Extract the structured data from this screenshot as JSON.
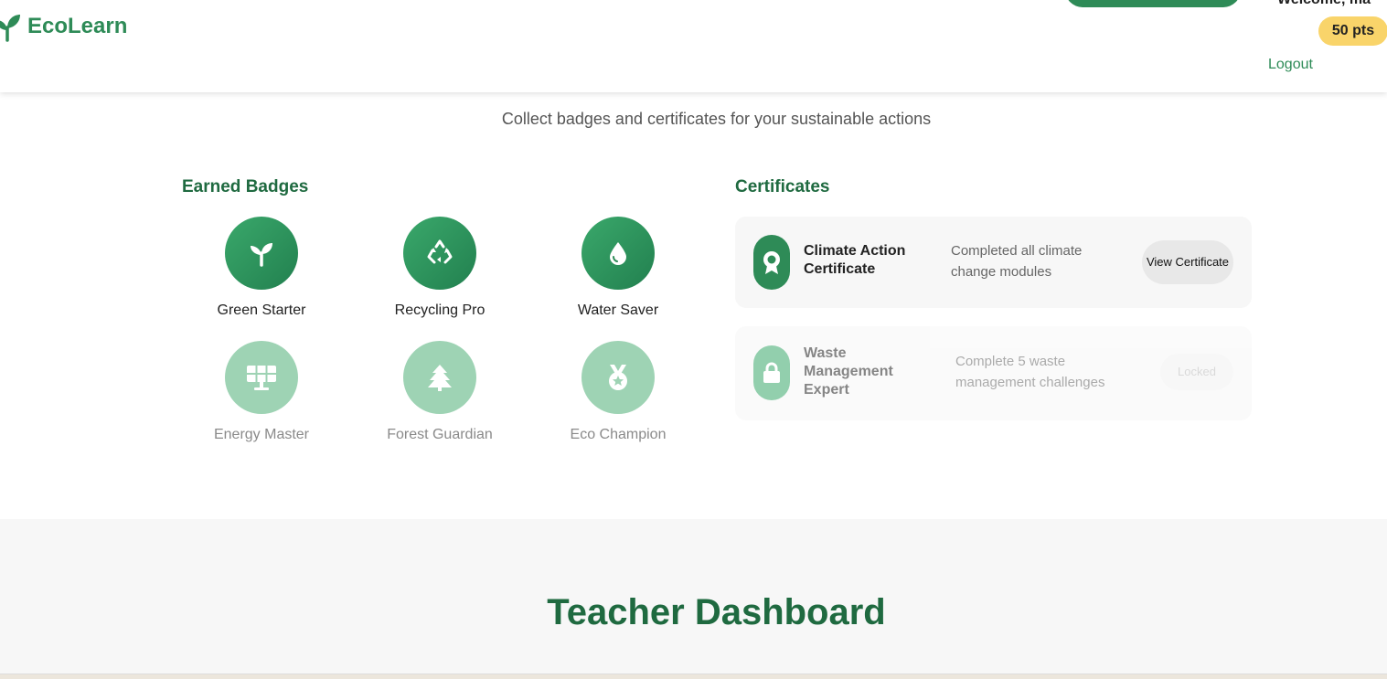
{
  "header": {
    "brand": "EcoLearn",
    "welcome": "Welcome, ma",
    "points": "50 pts",
    "logout": "Logout"
  },
  "intro": {
    "subtitle": "Collect badges and certificates for your sustainable actions"
  },
  "badges": {
    "title": "Earned Badges",
    "items": [
      {
        "label": "Green Starter",
        "icon": "sprout-icon",
        "earned": true
      },
      {
        "label": "Recycling Pro",
        "icon": "recycle-icon",
        "earned": true
      },
      {
        "label": "Water Saver",
        "icon": "water-drop-icon",
        "earned": true
      },
      {
        "label": "Energy Master",
        "icon": "solar-panel-icon",
        "earned": false
      },
      {
        "label": "Forest Guardian",
        "icon": "tree-icon",
        "earned": false
      },
      {
        "label": "Eco Champion",
        "icon": "medal-icon",
        "earned": false
      }
    ]
  },
  "certificates": {
    "title": "Certificates",
    "items": [
      {
        "name": "Climate Action Certificate",
        "description": "Completed all climate change modules",
        "action": "View Certificate",
        "icon": "award-icon",
        "locked": false
      },
      {
        "name": "Waste Management Expert",
        "description": "Complete 5 waste management challenges",
        "action": "Locked",
        "icon": "lock-icon",
        "locked": true
      }
    ]
  },
  "teacher": {
    "title": "Teacher Dashboard"
  },
  "colors": {
    "brand": "#2e8b57",
    "heading": "#1f6a40",
    "points_badge": "#f9d46a",
    "locked_badge": "#9ed3b4"
  }
}
